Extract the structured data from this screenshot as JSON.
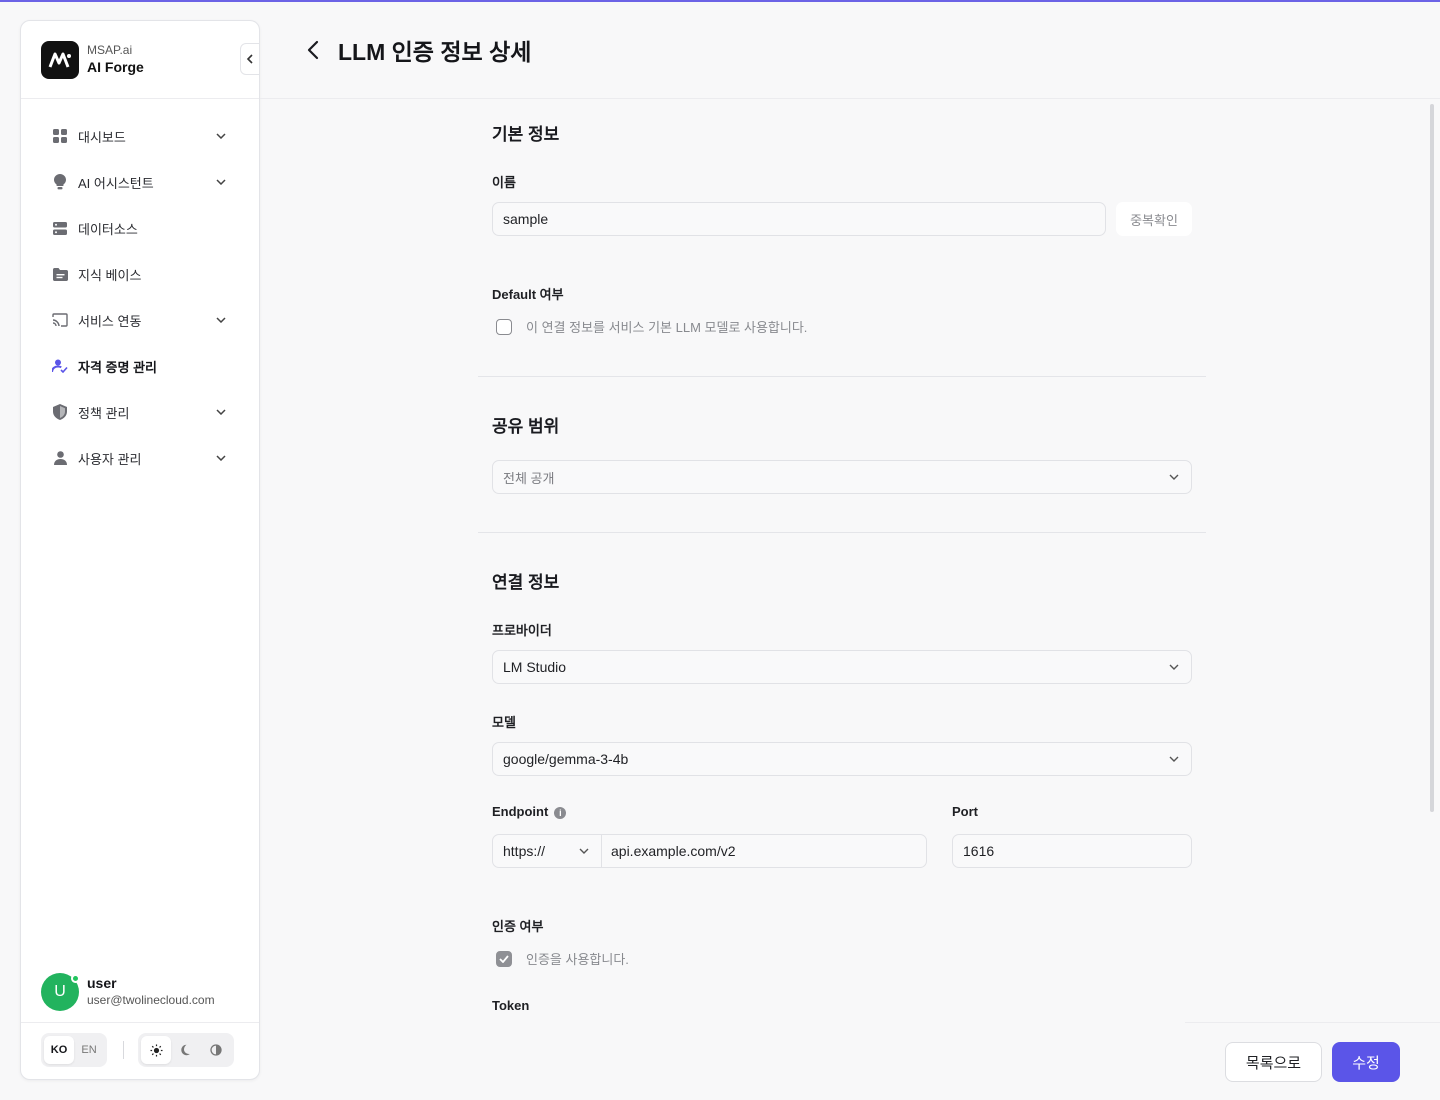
{
  "brand": {
    "sub": "MSAP.ai",
    "title": "AI Forge"
  },
  "sidebar": {
    "items": [
      {
        "label": "대시보드",
        "icon": "dashboard-icon",
        "expandable": true
      },
      {
        "label": "AI 어시스턴트",
        "icon": "bulb-icon",
        "expandable": true
      },
      {
        "label": "데이터소스",
        "icon": "server-icon",
        "expandable": false
      },
      {
        "label": "지식 베이스",
        "icon": "folder-icon",
        "expandable": false
      },
      {
        "label": "서비스 연동",
        "icon": "cast-icon",
        "expandable": true
      },
      {
        "label": "자격 증명 관리",
        "icon": "user-check-icon",
        "expandable": false,
        "active": true
      },
      {
        "label": "정책 관리",
        "icon": "shield-icon",
        "expandable": true
      },
      {
        "label": "사용자 관리",
        "icon": "person-icon",
        "expandable": true
      }
    ]
  },
  "user": {
    "initial": "U",
    "name": "user",
    "email": "user@twolinecloud.com"
  },
  "lang": {
    "ko": "KO",
    "en": "EN",
    "selected": "KO"
  },
  "theme": {
    "selected": "light"
  },
  "header": {
    "title": "LLM 인증 정보 상세"
  },
  "basic": {
    "title": "기본 정보",
    "name_label": "이름",
    "name_value": "sample",
    "dup_check": "중복확인",
    "default_label": "Default 여부",
    "default_checkbox": "이 연결 정보를 서비스 기본 LLM 모델로 사용합니다.",
    "default_checked": false
  },
  "share": {
    "title": "공유 범위",
    "value": "전체 공개"
  },
  "connection": {
    "title": "연결 정보",
    "provider_label": "프로바이더",
    "provider_value": "LM Studio",
    "model_label": "모델",
    "model_value": "google/gemma-3-4b",
    "endpoint_label": "Endpoint",
    "protocol": "https://",
    "endpoint_value": "api.example.com/v2",
    "port_label": "Port",
    "port_value": "1616",
    "auth_label": "인증 여부",
    "auth_checkbox": "인증을 사용합니다.",
    "auth_checked": true,
    "token_label": "Token"
  },
  "actions": {
    "list": "목록으로",
    "edit": "수정"
  },
  "colors": {
    "accent": "#5b55e8",
    "avatar": "#22b35e"
  }
}
